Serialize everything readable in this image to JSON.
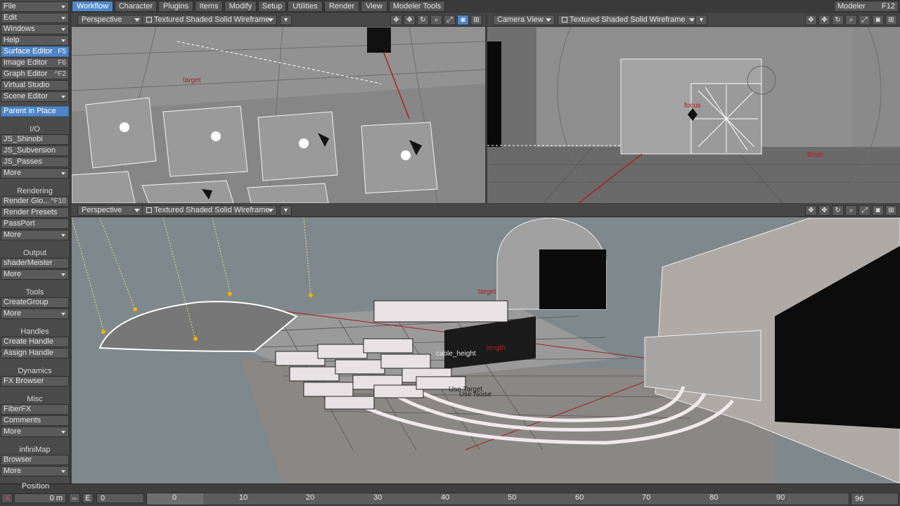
{
  "menu": {
    "file": "File",
    "edit": "Edit",
    "windows": "Windows",
    "help": "Help",
    "surface_editor": "Surface Editor",
    "surface_editor_key": "F5",
    "image_editor": "Image Editor",
    "image_editor_key": "F6",
    "graph_editor": "Graph Editor",
    "graph_editor_key": "^F2",
    "virtual_studio": "Virtual Studio",
    "scene_editor": "Scene Editor",
    "parent_in_place": "Parent in Place"
  },
  "sections": {
    "io": {
      "title": "I/O",
      "items": [
        "JS_Shinobi",
        "JS_Subversion",
        "JS_Passes"
      ],
      "more": "More"
    },
    "rendering": {
      "title": "Rendering",
      "render_glo": "Render Glo...",
      "render_glo_key": "^F10",
      "items": [
        "Render Presets",
        "PassPort"
      ],
      "more": "More"
    },
    "output": {
      "title": "Output",
      "items": [
        "shaderMeister"
      ],
      "more": "More"
    },
    "tools": {
      "title": "Tools",
      "items": [
        "CreateGroup"
      ],
      "more": "More"
    },
    "handles": {
      "title": "Handles",
      "items": [
        "Create Handle",
        "Assign Handle"
      ]
    },
    "dynamics": {
      "title": "Dynamics",
      "items": [
        "FX Browser"
      ]
    },
    "misc": {
      "title": "Misc",
      "items": [
        "FiberFX",
        "Comments"
      ],
      "more": "More"
    },
    "infinimap": {
      "title": "infiniMap",
      "items": [
        "Browser"
      ],
      "more": "More"
    }
  },
  "tabs": [
    "Workflow",
    "Character",
    "Plugins",
    "Items",
    "Modify",
    "Setup",
    "Utilities",
    "Render",
    "View",
    "Modeler Tools"
  ],
  "active_tab": "Workflow",
  "modeler": {
    "label": "Modeler",
    "key": "F12"
  },
  "viewports": {
    "top_left": {
      "view": "Perspective",
      "mode": "Textured Shaded Solid Wireframe",
      "labels": {
        "target": "target"
      }
    },
    "top_right": {
      "view": "Camera View",
      "mode": "Textured Shaded Solid Wireframe",
      "labels": {
        "focus": "focus",
        "boun": "Boun"
      }
    },
    "bottom": {
      "view": "Perspective",
      "mode": "Textured Shaded Solid Wireframe",
      "labels": {
        "target": "target",
        "use_target": "Use Target",
        "use_noise": "Use Noise",
        "cable_height": "cable_height",
        "length": "length"
      }
    }
  },
  "timeline": {
    "position_label": "Position",
    "position_value": "0 m",
    "e_label": "E",
    "frame_value": "0",
    "ticks": [
      "0",
      "10",
      "20",
      "30",
      "40",
      "50",
      "60",
      "70",
      "80",
      "90"
    ],
    "end_frame": "96",
    "current_frame": 0,
    "range": [
      0,
      96
    ]
  }
}
